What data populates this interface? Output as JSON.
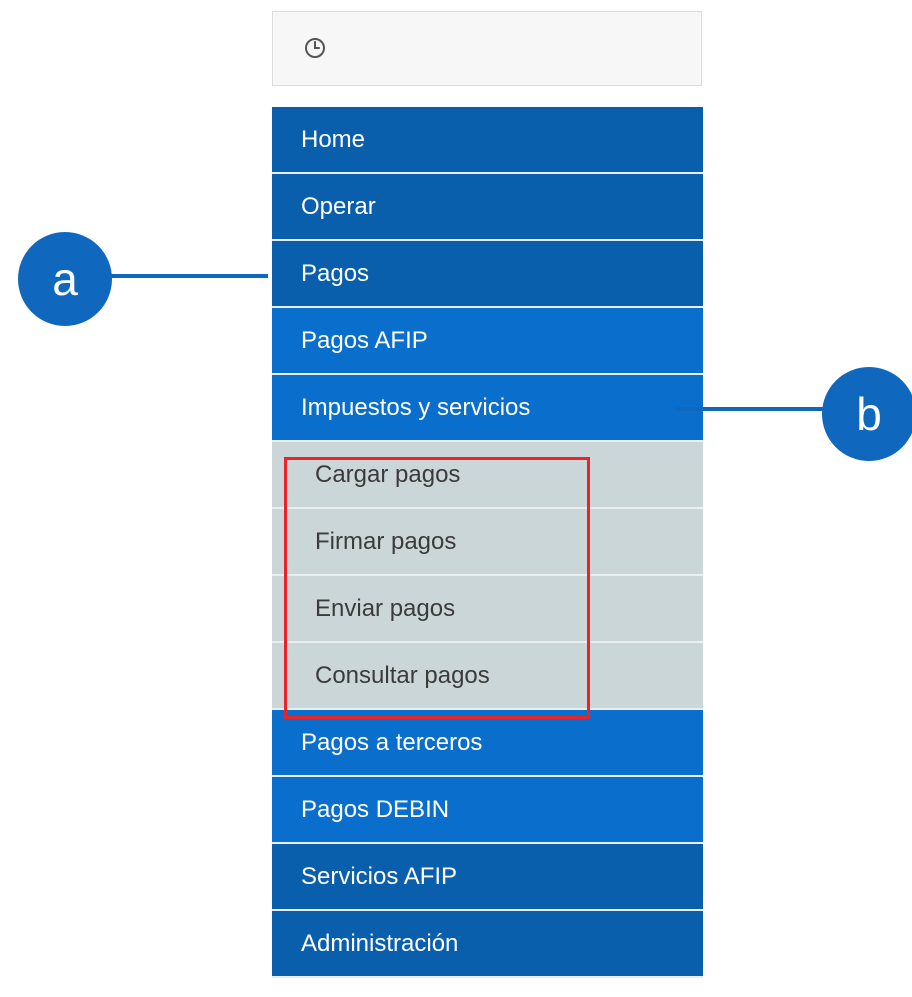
{
  "clock": {
    "icon": "clock-icon"
  },
  "menu": {
    "items": [
      {
        "label": "Home",
        "shade": "dark"
      },
      {
        "label": "Operar",
        "shade": "dark"
      },
      {
        "label": "Pagos",
        "shade": "dark"
      },
      {
        "label": "Pagos AFIP",
        "shade": "light"
      },
      {
        "label": "Impuestos y servicios",
        "shade": "light"
      }
    ],
    "submenu": [
      {
        "label": "Cargar pagos"
      },
      {
        "label": "Firmar pagos"
      },
      {
        "label": "Enviar pagos"
      },
      {
        "label": "Consultar pagos"
      }
    ],
    "items_after": [
      {
        "label": "Pagos a terceros",
        "shade": "light"
      },
      {
        "label": "Pagos DEBIN",
        "shade": "light"
      },
      {
        "label": "Servicios AFIP",
        "shade": "dark"
      },
      {
        "label": "Administración",
        "shade": "dark"
      }
    ]
  },
  "callouts": {
    "a": "a",
    "b": "b"
  },
  "colors": {
    "menu_dark": "#0a5fac",
    "menu_light": "#0a6fcc",
    "submenu_bg": "#cbd6d8",
    "highlight": "#e8232a",
    "callout": "#0f68bd"
  }
}
